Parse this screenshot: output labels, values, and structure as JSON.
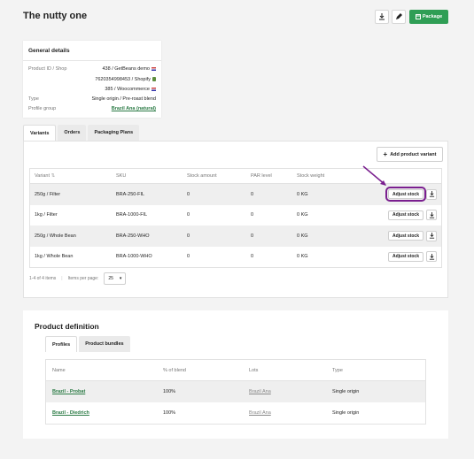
{
  "page": {
    "title": "The nutty one"
  },
  "header": {
    "package_label": "Package"
  },
  "general": {
    "title": "General details",
    "rows": [
      {
        "key": "Product ID / Shop",
        "value": "438 / GetBeans demo"
      },
      {
        "key": "",
        "value": "7620354998453 / Shopify"
      },
      {
        "key": "",
        "value": "385 / Woocommerce"
      },
      {
        "key": "Type",
        "value": "Single origin / Pre-roast blend"
      },
      {
        "key": "Profile group",
        "value": "Brazil Ana (natural)"
      }
    ]
  },
  "tabs": [
    "Variants",
    "Orders",
    "Packaging Plans"
  ],
  "variants": {
    "add_label": "Add product variant",
    "columns": [
      "Variant",
      "SKU",
      "Stock amount",
      "PAR level",
      "Stock weight"
    ],
    "adjust_label": "Adjust stock",
    "rows": [
      {
        "variant": "250g / Filter",
        "sku": "BRA-250-FIL",
        "stock": "0",
        "par": "0",
        "weight": "0 KG"
      },
      {
        "variant": "1kg / Filter",
        "sku": "BRA-1000-FIL",
        "stock": "0",
        "par": "0",
        "weight": "0 KG"
      },
      {
        "variant": "250g / Whole Bean",
        "sku": "BRA-250-WHO",
        "stock": "0",
        "par": "0",
        "weight": "0 KG"
      },
      {
        "variant": "1kg / Whole Bean",
        "sku": "BRA-1000-WHO",
        "stock": "0",
        "par": "0",
        "weight": "0 KG"
      }
    ],
    "pager": {
      "range": "1-4 of 4 items",
      "per_page_label": "Items per page:",
      "per_page": "25"
    }
  },
  "definition": {
    "title": "Product definition",
    "tabs": [
      "Profiles",
      "Product bundles"
    ],
    "columns": [
      "Name",
      "% of blend",
      "Lots",
      "Type"
    ],
    "rows": [
      {
        "name": "Brazil - Probat",
        "blend": "100%",
        "lot": "Brazil Ana",
        "type": "Single origin"
      },
      {
        "name": "Brazil - Diedrich",
        "blend": "100%",
        "lot": "Brazil Ana",
        "type": "Single origin"
      }
    ]
  },
  "colors": {
    "accent": "#2f9e55",
    "highlight": "#7a1f8f"
  }
}
